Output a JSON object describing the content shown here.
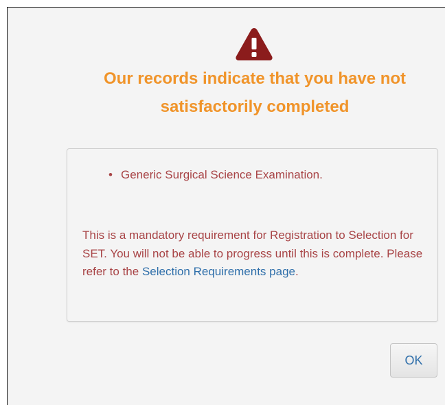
{
  "alert": {
    "icon": "warning-triangle-icon",
    "icon_color": "#8b1c1c",
    "heading_line1": "Our records indicate that you have not",
    "heading_line2": "satisfactorily completed",
    "heading_color": "#f0942a"
  },
  "message": {
    "items": [
      "Generic Surgical Science Examination."
    ],
    "requirement_text": "This is a mandatory requirement for Registration to Selection for SET. You will not be able to progress until this is complete. Please refer to the",
    "link_text": "Selection Requirements page",
    "trailing_text": ".",
    "text_color": "#a84446",
    "link_color": "#2f6faa"
  },
  "buttons": {
    "ok_label": "OK"
  }
}
